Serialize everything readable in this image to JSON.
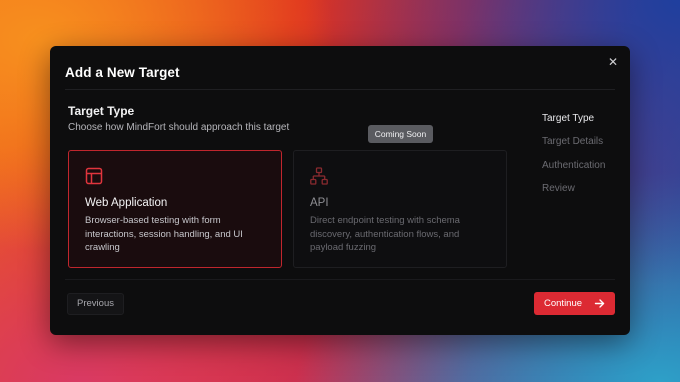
{
  "dialog": {
    "title": "Add a New Target",
    "close_icon": "close-icon"
  },
  "section": {
    "title": "Target Type",
    "description": "Choose how MindFort should approach this target"
  },
  "cards": [
    {
      "icon": "layout-icon",
      "title": "Web Application",
      "description": "Browser-based testing with form interactions, session handling, and UI crawling",
      "selected": true
    },
    {
      "icon": "network-hierarchy-icon",
      "title": "API",
      "description": "Direct endpoint testing with schema discovery, authentication flows, and payload fuzzing",
      "selected": false,
      "badge": "Coming Soon"
    }
  ],
  "steps": [
    {
      "label": "Target Type",
      "active": true
    },
    {
      "label": "Target Details",
      "active": false
    },
    {
      "label": "Authentication",
      "active": false
    },
    {
      "label": "Review",
      "active": false
    }
  ],
  "footer": {
    "previous_label": "Previous",
    "continue_label": "Continue",
    "continue_icon": "arrow-right-icon"
  },
  "colors": {
    "accent": "#dc2a33",
    "selected_border": "#c0262d",
    "modal_bg": "#0d0d0e"
  }
}
